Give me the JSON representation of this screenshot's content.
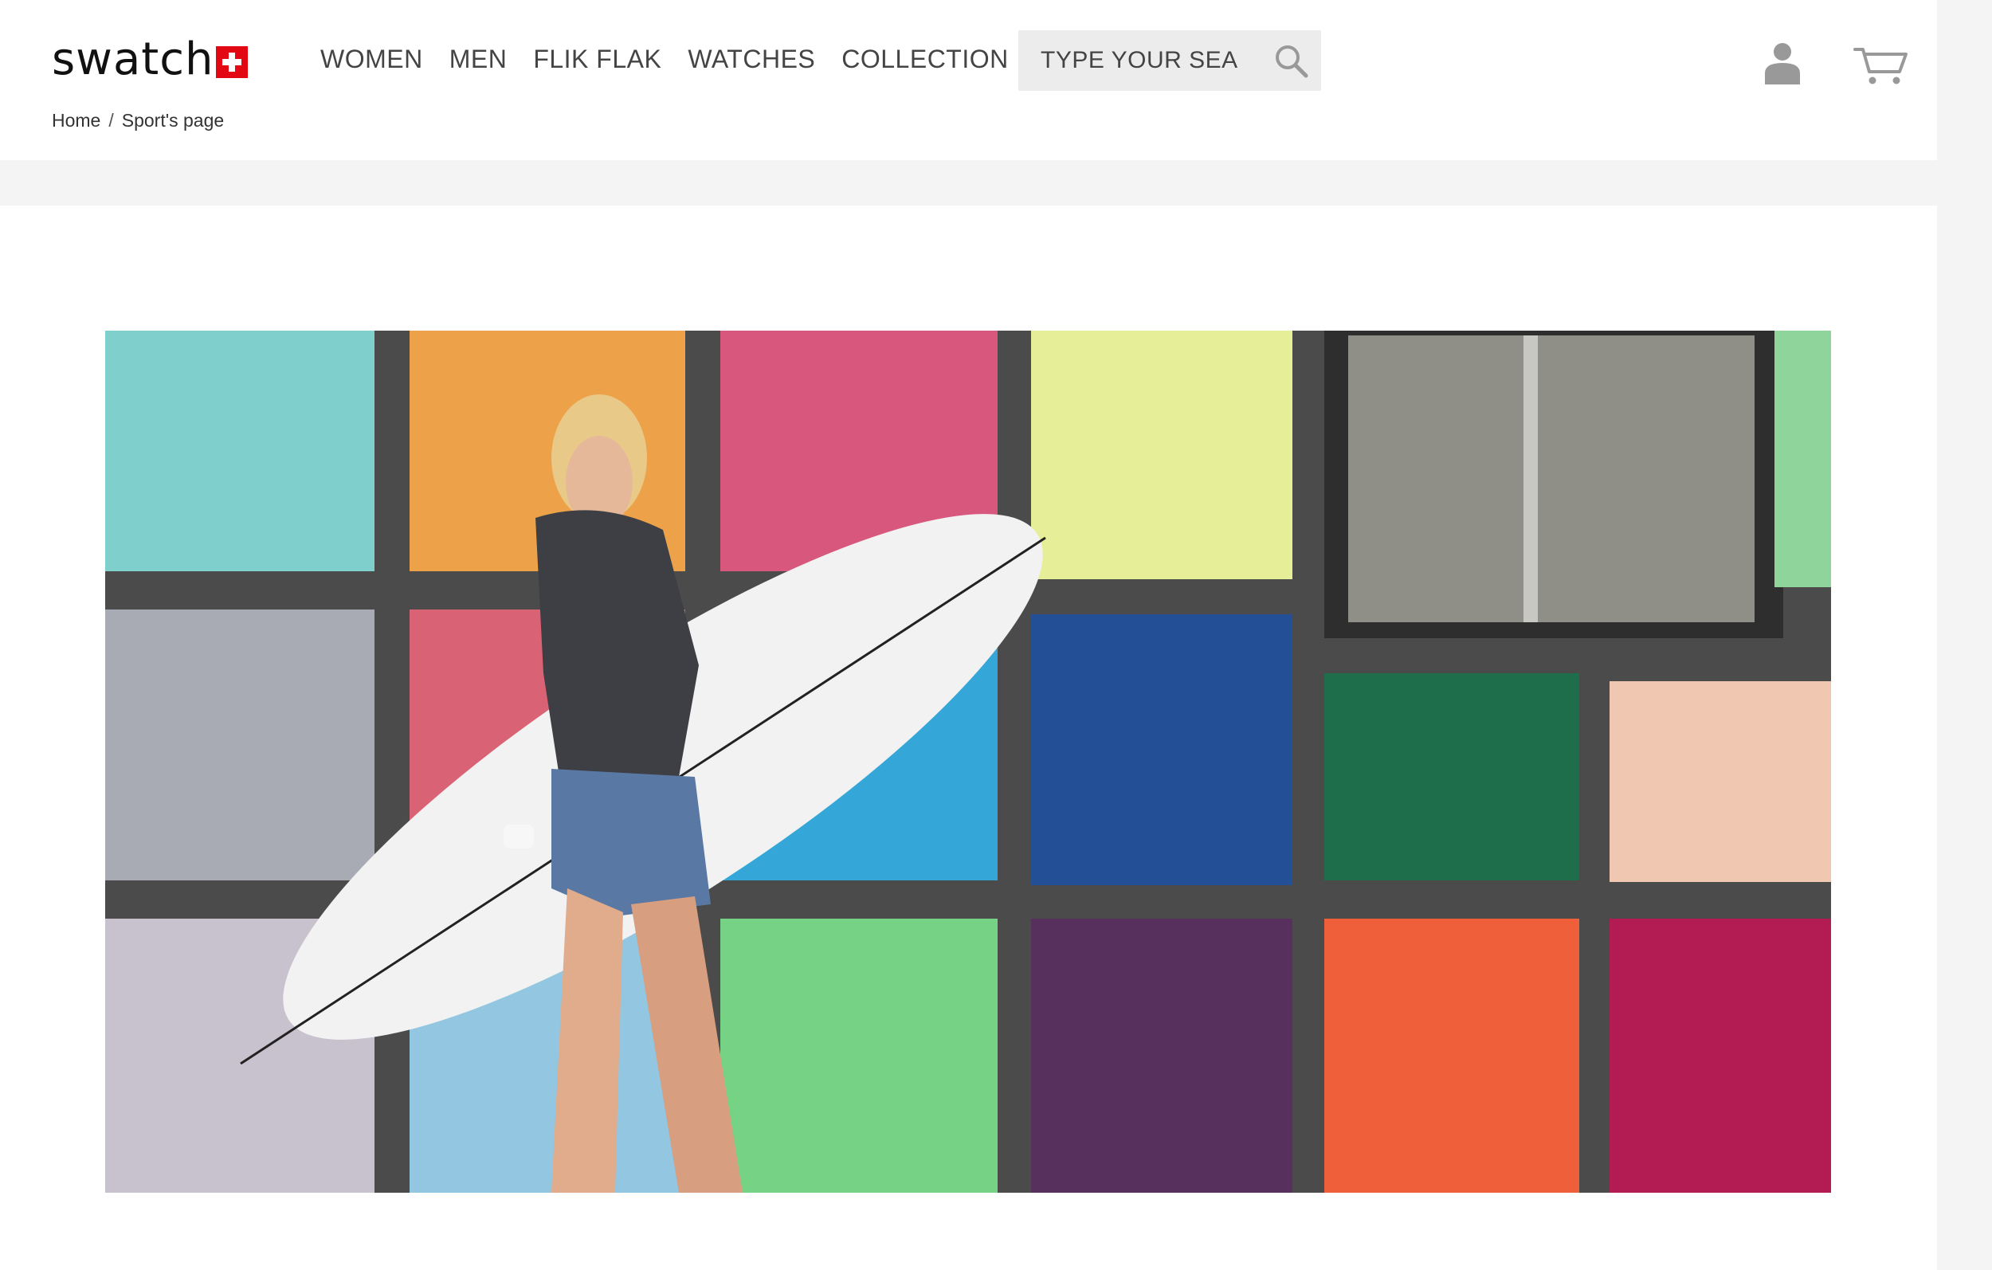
{
  "brand": {
    "name": "swatch",
    "cross_color": "#e30613"
  },
  "nav": {
    "items": [
      {
        "label": "WOMEN"
      },
      {
        "label": "MEN"
      },
      {
        "label": "FLIK FLAK"
      },
      {
        "label": "WATCHES"
      },
      {
        "label": "COLLECTION"
      }
    ]
  },
  "search": {
    "placeholder": "TYPE YOUR SEAR",
    "icon": "search-icon"
  },
  "account": {
    "user_icon": "user-icon",
    "cart_icon": "cart-icon"
  },
  "breadcrumb": {
    "home": "Home",
    "separator": "/",
    "current": "Sport's page"
  },
  "hero": {
    "description_icon": "hero-image"
  }
}
